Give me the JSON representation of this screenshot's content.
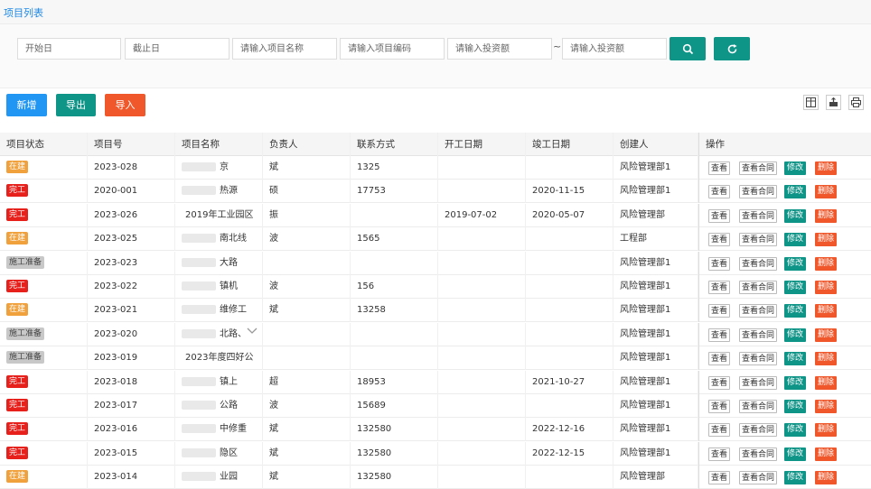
{
  "page": {
    "title": "项目列表"
  },
  "filters": {
    "start_date": "开始日",
    "end_date": "截止日",
    "project_name": "请输入项目名称",
    "project_code": "请输入项目编码",
    "invest_min": "请输入投资额",
    "range_sep": "~",
    "invest_max": "请输入投资额"
  },
  "toolbar": {
    "add": "新增",
    "export": "导出",
    "import": "导入"
  },
  "colors": {
    "teal": "#0f9488",
    "blue": "#2196f3",
    "orange": "#f0582c",
    "in_progress": "#f0a13c",
    "done": "#e8201c",
    "prep": "#c8c8c8"
  },
  "icons": [
    "search-icon",
    "refresh-icon",
    "columns-icon",
    "export-icon",
    "print-icon",
    "chevron-down-icon"
  ],
  "columns": [
    "项目状态",
    "项目号",
    "项目名称",
    "负责人",
    "联系方式",
    "开工日期",
    "竣工日期",
    "创建人",
    "操作"
  ],
  "actions": {
    "view": "查看",
    "contract": "查看合同",
    "edit": "修改",
    "delete": "删除"
  },
  "rows": [
    {
      "status": "在建",
      "code": "2023-028",
      "name": "京",
      "owner": "斌",
      "phone": "1325",
      "start": "",
      "end": "",
      "creator": "风险管理部1"
    },
    {
      "status": "完工",
      "code": "2020-001",
      "name": "热源",
      "owner": "硕",
      "phone": "17753",
      "start": "",
      "end": "2020-11-15",
      "creator": "风险管理部1"
    },
    {
      "status": "完工",
      "code": "2023-026",
      "name": "2019年工业园区",
      "owner": "振",
      "phone": "",
      "start": "2019-07-02",
      "end": "2020-05-07",
      "creator": "风险管理部"
    },
    {
      "status": "在建",
      "code": "2023-025",
      "name": "南北线",
      "owner": "波",
      "phone": "1565",
      "start": "",
      "end": "",
      "creator": "工程部"
    },
    {
      "status": "施工准备",
      "code": "2023-023",
      "name": "大路",
      "owner": "",
      "phone": "",
      "start": "",
      "end": "",
      "creator": "风险管理部1"
    },
    {
      "status": "完工",
      "code": "2023-022",
      "name": "镇机",
      "owner": "波",
      "phone": "156",
      "start": "",
      "end": "",
      "creator": "风险管理部1"
    },
    {
      "status": "在建",
      "code": "2023-021",
      "name": "维修工",
      "owner": "斌",
      "phone": "13258",
      "start": "",
      "end": "",
      "creator": "风险管理部1"
    },
    {
      "status": "施工准备",
      "code": "2023-020",
      "name": "北路、",
      "owner": "",
      "phone": "",
      "start": "",
      "end": "",
      "creator": "风险管理部1"
    },
    {
      "status": "施工准备",
      "code": "2023-019",
      "name": "2023年度四好公",
      "owner": "",
      "phone": "",
      "start": "",
      "end": "",
      "creator": "风险管理部1"
    },
    {
      "status": "完工",
      "code": "2023-018",
      "name": "镇上",
      "owner": "超",
      "phone": "18953",
      "start": "",
      "end": "2021-10-27",
      "creator": "风险管理部1"
    },
    {
      "status": "完工",
      "code": "2023-017",
      "name": "公路",
      "owner": "波",
      "phone": "15689",
      "start": "",
      "end": "",
      "creator": "风险管理部1"
    },
    {
      "status": "完工",
      "code": "2023-016",
      "name": "中修重",
      "owner": "斌",
      "phone": "132580",
      "start": "",
      "end": "2022-12-16",
      "creator": "风险管理部1"
    },
    {
      "status": "完工",
      "code": "2023-015",
      "name": "隐区",
      "owner": "斌",
      "phone": "132580",
      "start": "",
      "end": "2022-12-15",
      "creator": "风险管理部1"
    },
    {
      "status": "在建",
      "code": "2023-014",
      "name": "业园",
      "owner": "斌",
      "phone": "132580",
      "start": "",
      "end": "",
      "creator": "风险管理部"
    }
  ]
}
